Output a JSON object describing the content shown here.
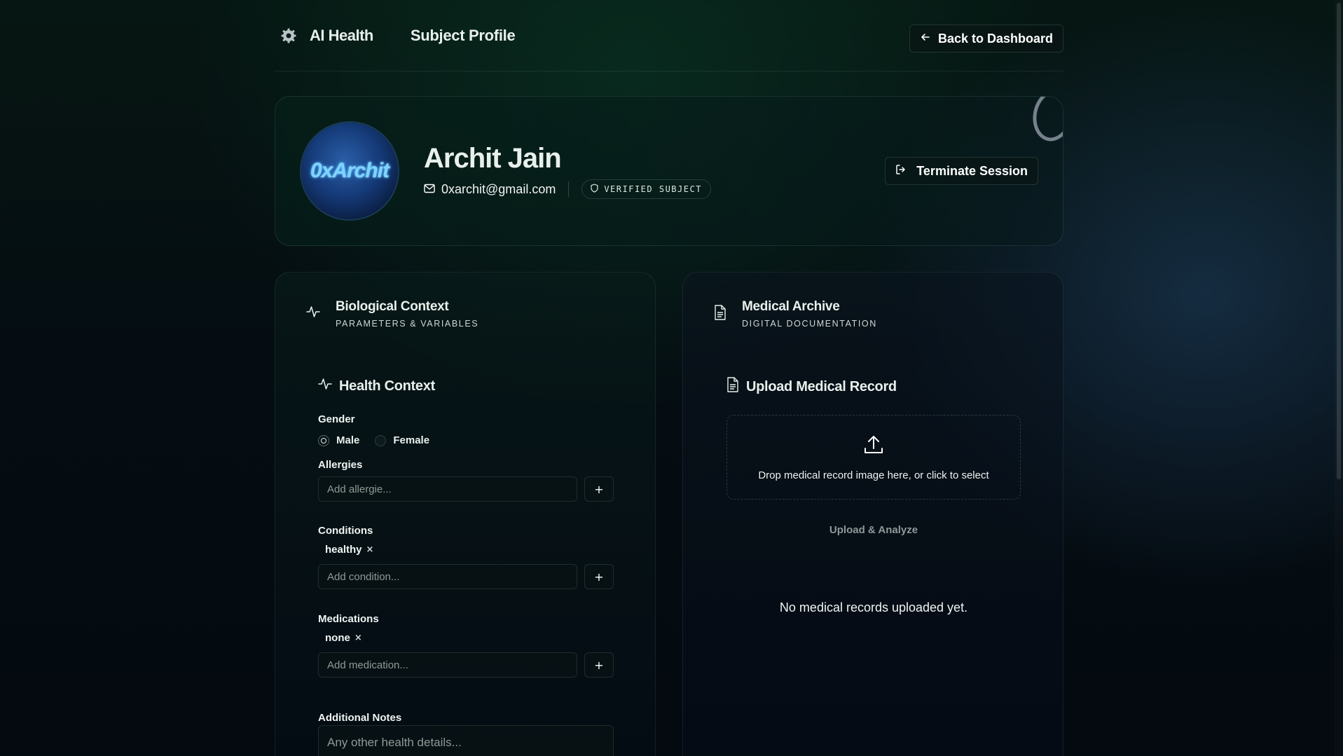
{
  "header": {
    "brand_name": "AI Health",
    "page_title": "Subject Profile",
    "back_label": "Back to Dashboard"
  },
  "profile": {
    "avatar_text": "0xArchit",
    "name": "Archit Jain",
    "email": "0xarchit@gmail.com",
    "badge": "VERIFIED SUBJECT",
    "terminate_label": "Terminate Session"
  },
  "biological": {
    "title": "Biological Context",
    "subtitle": "PARAMETERS & VARIABLES",
    "section_title": "Health Context",
    "gender_label": "Gender",
    "gender_options": [
      "Male",
      "Female"
    ],
    "gender_selected": "Male",
    "allergies_label": "Allergies",
    "allergies_placeholder": "Add allergie...",
    "conditions_label": "Conditions",
    "conditions": [
      "healthy"
    ],
    "conditions_placeholder": "Add condition...",
    "medications_label": "Medications",
    "medications": [
      "none"
    ],
    "medications_placeholder": "Add medication...",
    "notes_label": "Additional Notes",
    "notes_placeholder": "Any other health details...",
    "add_button": "+",
    "remove_glyph": "×"
  },
  "archive": {
    "title": "Medical Archive",
    "subtitle": "DIGITAL DOCUMENTATION",
    "upload_title": "Upload Medical Record",
    "drop_text": "Drop medical record image here, or click to select",
    "analyze_label": "Upload & Analyze",
    "empty_text": "No medical records uploaded yet."
  },
  "colors": {
    "background": "#050d12",
    "accent_green": "#0a2e24",
    "text": "#e8f0ec",
    "muted": "#8c9a98"
  }
}
